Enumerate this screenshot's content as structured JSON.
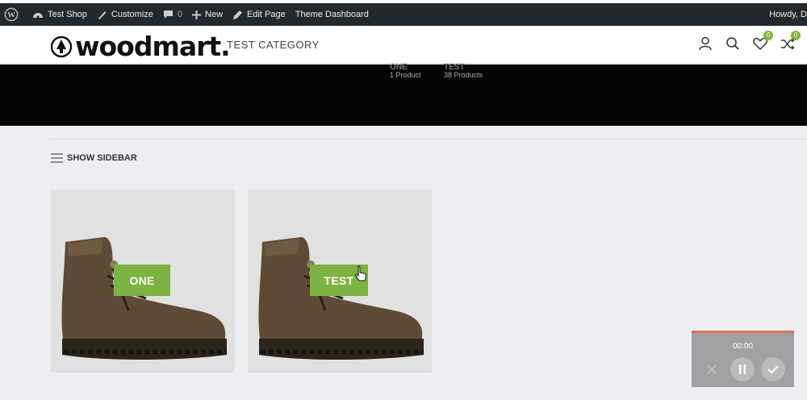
{
  "adminbar": {
    "site_name": "Test Shop",
    "customize": "Customize",
    "comments_count": "0",
    "new": "New",
    "edit_page": "Edit Page",
    "theme_dashboard": "Theme Dashboard",
    "howdy": "Howdy, D"
  },
  "header": {
    "logo": "woodmart.",
    "category_title": "TEST CATEGORY",
    "wishlist_count": "0",
    "compare_count": "0"
  },
  "banner": {
    "categories": [
      {
        "name": "ONE",
        "count": "1 Product"
      },
      {
        "name": "TEST",
        "count": "38 Products"
      }
    ]
  },
  "toolbar": {
    "show_sidebar": "SHOW SIDEBAR"
  },
  "products": [
    {
      "label": "ONE"
    },
    {
      "label": "TEST"
    }
  ],
  "recorder": {
    "time": "00:00"
  },
  "colors": {
    "accent": "#7cb342",
    "adminbar": "#23282d",
    "banner": "#050505"
  }
}
